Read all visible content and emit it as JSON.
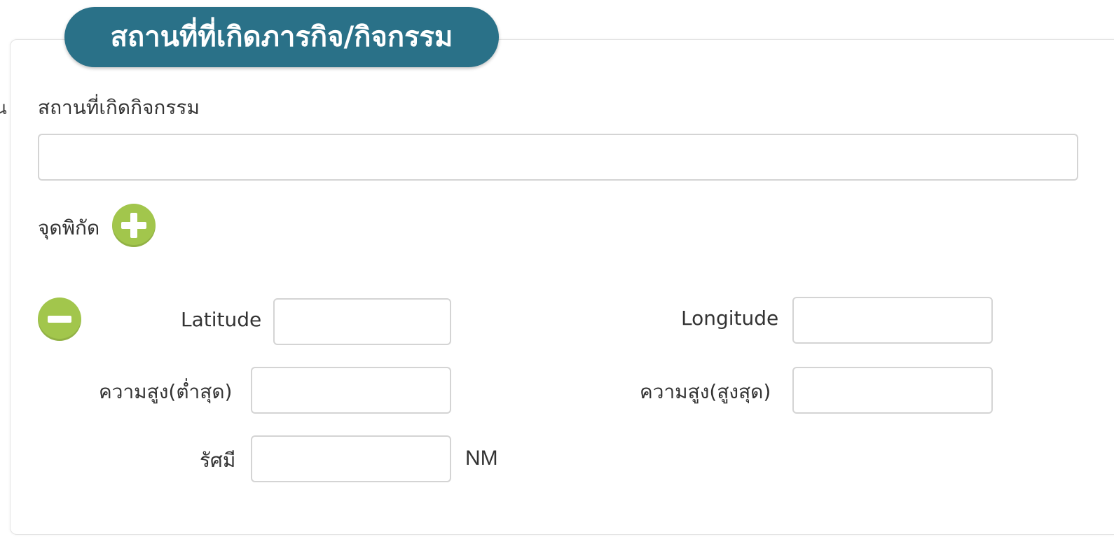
{
  "left_edge_text": "น",
  "section": {
    "title": "สถานที่ที่เกิดภารกิจ/กิจกรรม"
  },
  "location": {
    "label": "สถานที่เกิดกิจกรรม",
    "value": ""
  },
  "coordinates": {
    "label": "จุดพิกัด",
    "add_icon": "plus-circle-icon",
    "remove_icon": "minus-circle-icon",
    "latitude_label": "Latitude",
    "latitude_value": "",
    "longitude_label": "Longitude",
    "longitude_value": "",
    "alt_min_label": "ความสูง(ต่ำสุด)",
    "alt_min_value": "",
    "alt_max_label": "ความสูง(สูงสุด)",
    "alt_max_value": "",
    "radius_label": "รัศมี",
    "radius_value": "",
    "radius_unit": "NM"
  },
  "colors": {
    "title_bg": "#2a7188",
    "button_green": "#a2c64c"
  }
}
